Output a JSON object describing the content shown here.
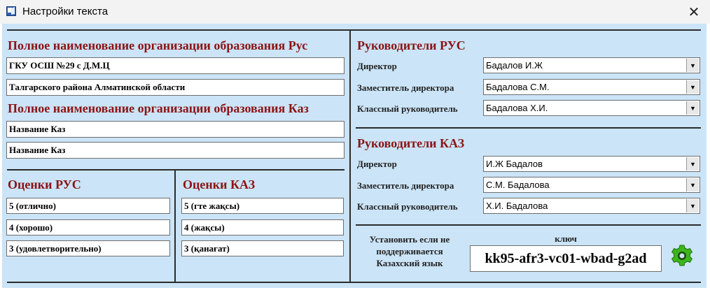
{
  "window": {
    "title": "Настройки текста",
    "close_glyph": "✕",
    "app_icon": "application-icon"
  },
  "left": {
    "org_rus": {
      "heading": "Полное наименование организации образования Рус",
      "line1": "ГКУ ОСШ №29 с Д.М.Ц",
      "line2": "Талгарского района Алматинской области"
    },
    "org_kaz": {
      "heading": "Полное наименование организации образования Каз",
      "line1": "Название Каз",
      "line2": "Название Каз"
    },
    "grades_rus": {
      "heading": "Оценки РУС",
      "items": [
        "5 (отлично)",
        "4 (хорошо)",
        "3 (удовлетворительно)"
      ]
    },
    "grades_kaz": {
      "heading": "Оценки КАЗ",
      "items": [
        "5 (гте жақсы)",
        "4 (жақсы)",
        "3 (қанағат)"
      ]
    }
  },
  "right": {
    "leaders_rus": {
      "heading": "Руководители РУС",
      "rows": [
        {
          "label": "Директор",
          "value": "Бадалов И.Ж"
        },
        {
          "label": "Заместитель директора",
          "value": "Бадалова С.М."
        },
        {
          "label": "Классный руководитель",
          "value": "Бадалова Х.И."
        }
      ]
    },
    "leaders_kaz": {
      "heading": "Руководители КАЗ",
      "rows": [
        {
          "label": "Директор",
          "value": "И.Ж Бадалов"
        },
        {
          "label": "Заместитель директора",
          "value": "С.М. Бадалова"
        },
        {
          "label": "Классный руководитель",
          "value": "Х.И. Бадалова"
        }
      ]
    },
    "key": {
      "note_line1": "Установить если не",
      "note_line2": "поддерживается",
      "note_line3": "Казахский язык",
      "label": "ключ",
      "value": "kk95-afr3-vc01-wbad-g2ad",
      "apply_icon": "gear-icon",
      "gear_color": "#3db51e"
    }
  },
  "dropdown_glyph": "▼"
}
